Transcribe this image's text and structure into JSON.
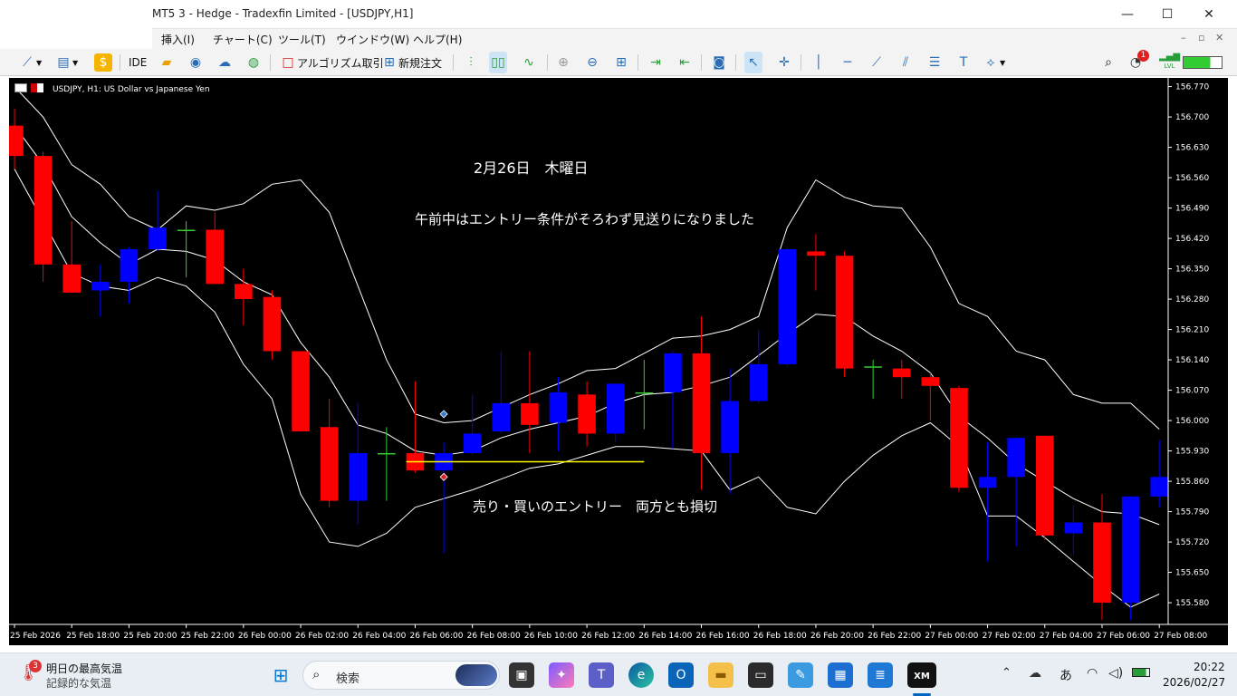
{
  "window": {
    "title": "MT5 3 - Hedge - Tradexfin Limited - [USDJPY,H1]",
    "minimize_glyph": "—",
    "maximize_glyph": "☐",
    "close_glyph": "✕"
  },
  "menu": {
    "items": [
      "挿入(I)",
      "チャート(C)",
      "ツール(T)",
      "ウインドウ(W)",
      "ヘルプ(H)"
    ],
    "mdi_controls": [
      "–",
      "▫",
      "✕"
    ]
  },
  "toolbar": {
    "ide_label": "IDE",
    "algo_label": "アルゴリズム取引",
    "new_order_label": "新規注文",
    "notification_count": "1",
    "lvl_label": "LVL"
  },
  "chart": {
    "symbol_title": "USDJPY, H1:  US Dollar vs Japanese Yen",
    "annotations": {
      "date": "2月26日　木曜日",
      "morning_note": "午前中はエントリー条件がそろわず見送りになりました",
      "entry_note": "売り・買いのエントリー　両方とも損切"
    },
    "colors": {
      "background": "#000000",
      "bull": "#0000ff",
      "bear": "#ff0000",
      "band": "#ffffff",
      "line": "#ffff00"
    }
  },
  "chart_data": {
    "type": "candlestick",
    "symbol": "USDJPY",
    "timeframe": "H1",
    "y_ticks": [
      "156.770",
      "156.700",
      "156.630",
      "156.560",
      "156.490",
      "156.420",
      "156.350",
      "156.280",
      "156.210",
      "156.140",
      "156.070",
      "156.000",
      "155.930",
      "155.860",
      "155.790",
      "155.720",
      "155.650",
      "155.580"
    ],
    "ylim": [
      155.53,
      156.79
    ],
    "x_ticks": [
      "25 Feb 2026",
      "25 Feb 18:00",
      "25 Feb 20:00",
      "25 Feb 22:00",
      "26 Feb 00:00",
      "26 Feb 02:00",
      "26 Feb 04:00",
      "26 Feb 06:00",
      "26 Feb 08:00",
      "26 Feb 10:00",
      "26 Feb 12:00",
      "26 Feb 14:00",
      "26 Feb 16:00",
      "26 Feb 18:00",
      "26 Feb 20:00",
      "26 Feb 22:00",
      "27 Feb 00:00",
      "27 Feb 02:00",
      "27 Feb 04:00",
      "27 Feb 06:00",
      "27 Feb 08:00"
    ],
    "candles": [
      {
        "o": 156.68,
        "h": 156.72,
        "c": 156.61,
        "l": 156.58
      },
      {
        "o": 156.61,
        "h": 156.62,
        "c": 156.36,
        "l": 156.32
      },
      {
        "o": 156.36,
        "h": 156.46,
        "c": 156.295,
        "l": 156.295
      },
      {
        "o": 156.3,
        "h": 156.36,
        "c": 156.32,
        "l": 156.24
      },
      {
        "o": 156.32,
        "h": 156.4,
        "c": 156.395,
        "l": 156.27
      },
      {
        "o": 156.395,
        "h": 156.53,
        "c": 156.445,
        "l": 156.39
      },
      {
        "o": 156.44,
        "h": 156.46,
        "c": 156.44,
        "l": 156.33
      },
      {
        "o": 156.44,
        "h": 156.48,
        "c": 156.315,
        "l": 156.315
      },
      {
        "o": 156.315,
        "h": 156.35,
        "c": 156.28,
        "l": 156.22
      },
      {
        "o": 156.285,
        "h": 156.3,
        "c": 156.16,
        "l": 156.14
      },
      {
        "o": 156.16,
        "h": 156.16,
        "c": 155.975,
        "l": 155.975
      },
      {
        "o": 155.985,
        "h": 156.05,
        "c": 155.815,
        "l": 155.8
      },
      {
        "o": 155.815,
        "h": 156.04,
        "c": 155.925,
        "l": 155.76
      },
      {
        "o": 155.925,
        "h": 155.985,
        "c": 155.925,
        "l": 155.815
      },
      {
        "o": 155.925,
        "h": 156.09,
        "c": 155.885,
        "l": 155.88
      },
      {
        "o": 155.885,
        "h": 155.95,
        "c": 155.925,
        "l": 155.695
      },
      {
        "o": 155.925,
        "h": 156.06,
        "c": 155.97,
        "l": 155.92
      },
      {
        "o": 155.975,
        "h": 156.16,
        "c": 156.04,
        "l": 155.97
      },
      {
        "o": 156.04,
        "h": 156.16,
        "c": 155.99,
        "l": 155.925
      },
      {
        "o": 155.995,
        "h": 156.1,
        "c": 156.065,
        "l": 155.93
      },
      {
        "o": 156.06,
        "h": 156.09,
        "c": 155.97,
        "l": 155.94
      },
      {
        "o": 155.97,
        "h": 156.08,
        "c": 156.085,
        "l": 155.95
      },
      {
        "o": 156.065,
        "h": 156.14,
        "c": 156.065,
        "l": 155.98
      },
      {
        "o": 156.065,
        "h": 156.16,
        "c": 156.155,
        "l": 155.935
      },
      {
        "o": 156.155,
        "h": 156.24,
        "c": 155.925,
        "l": 155.84
      },
      {
        "o": 155.925,
        "h": 156.12,
        "c": 156.045,
        "l": 155.83
      },
      {
        "o": 156.045,
        "h": 156.21,
        "c": 156.13,
        "l": 156.04
      },
      {
        "o": 156.13,
        "h": 156.4,
        "c": 156.395,
        "l": 156.125
      },
      {
        "o": 156.39,
        "h": 156.43,
        "c": 156.38,
        "l": 156.3
      },
      {
        "o": 156.38,
        "h": 156.39,
        "c": 156.12,
        "l": 156.1
      },
      {
        "o": 156.125,
        "h": 156.14,
        "c": 156.125,
        "l": 156.05
      },
      {
        "o": 156.12,
        "h": 156.14,
        "c": 156.1,
        "l": 156.05
      },
      {
        "o": 156.1,
        "h": 156.11,
        "c": 156.08,
        "l": 156.0
      },
      {
        "o": 156.075,
        "h": 156.08,
        "c": 155.845,
        "l": 155.835
      },
      {
        "o": 155.845,
        "h": 155.95,
        "c": 155.87,
        "l": 155.675
      },
      {
        "o": 155.87,
        "h": 155.96,
        "c": 155.96,
        "l": 155.71
      },
      {
        "o": 155.965,
        "h": 155.965,
        "c": 155.735,
        "l": 155.725
      },
      {
        "o": 155.74,
        "h": 155.805,
        "c": 155.765,
        "l": 155.69
      },
      {
        "o": 155.765,
        "h": 155.83,
        "c": 155.58,
        "l": 155.54
      },
      {
        "o": 155.58,
        "h": 155.82,
        "c": 155.825,
        "l": 155.54
      },
      {
        "o": 155.825,
        "h": 155.955,
        "c": 155.87,
        "l": 155.8
      }
    ],
    "upper_band": [
      156.77,
      156.7,
      156.59,
      156.545,
      156.47,
      156.44,
      156.495,
      156.485,
      156.5,
      156.545,
      156.555,
      156.48,
      156.31,
      156.14,
      156.015,
      155.995,
      156.0,
      156.03,
      156.06,
      156.085,
      156.115,
      156.12,
      156.155,
      156.19,
      156.195,
      156.21,
      156.24,
      156.445,
      156.555,
      156.515,
      156.495,
      156.49,
      156.4,
      156.27,
      156.24,
      156.16,
      156.14,
      156.06,
      156.04,
      156.04,
      155.98
    ],
    "middle_band": [
      156.68,
      156.59,
      156.47,
      156.41,
      156.36,
      156.395,
      156.39,
      156.37,
      156.32,
      156.29,
      156.18,
      156.1,
      155.99,
      155.97,
      155.93,
      155.92,
      155.93,
      155.96,
      155.98,
      155.995,
      156.01,
      156.04,
      156.06,
      156.065,
      156.08,
      156.1,
      156.15,
      156.2,
      156.245,
      156.24,
      156.195,
      156.16,
      156.11,
      156.01,
      155.96,
      155.9,
      155.86,
      155.82,
      155.79,
      155.785,
      155.76
    ],
    "lower_band": [
      156.58,
      156.46,
      156.34,
      156.31,
      156.3,
      156.33,
      156.31,
      156.25,
      156.13,
      156.05,
      155.83,
      155.72,
      155.71,
      155.74,
      155.8,
      155.82,
      155.84,
      155.865,
      155.89,
      155.9,
      155.92,
      155.94,
      155.94,
      155.935,
      155.93,
      155.84,
      155.87,
      155.8,
      155.785,
      155.86,
      155.92,
      155.965,
      155.995,
      155.94,
      155.78,
      155.78,
      155.73,
      155.675,
      155.62,
      155.57,
      155.6
    ],
    "yellow_line": {
      "y": 155.905,
      "from_index": 14,
      "to_index": 22
    },
    "markers": [
      {
        "index": 15,
        "y": 156.015,
        "kind": "buy"
      },
      {
        "index": 15,
        "y": 155.87,
        "kind": "sell"
      }
    ]
  },
  "taskbar": {
    "weather_badge": "3",
    "weather_line1": "明日の最高気温",
    "weather_line2": "記録的な気温",
    "search_placeholder": "検索",
    "ime_label": "あ",
    "time": "20:22",
    "date": "2026/02/27"
  }
}
